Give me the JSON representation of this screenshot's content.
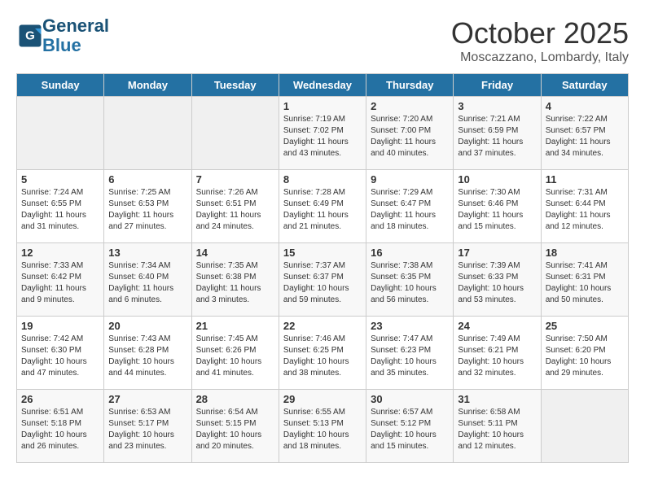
{
  "header": {
    "logo_line1": "General",
    "logo_line2": "Blue",
    "month": "October 2025",
    "location": "Moscazzano, Lombardy, Italy"
  },
  "days_of_week": [
    "Sunday",
    "Monday",
    "Tuesday",
    "Wednesday",
    "Thursday",
    "Friday",
    "Saturday"
  ],
  "weeks": [
    [
      {
        "day": "",
        "info": ""
      },
      {
        "day": "",
        "info": ""
      },
      {
        "day": "",
        "info": ""
      },
      {
        "day": "1",
        "info": "Sunrise: 7:19 AM\nSunset: 7:02 PM\nDaylight: 11 hours\nand 43 minutes."
      },
      {
        "day": "2",
        "info": "Sunrise: 7:20 AM\nSunset: 7:00 PM\nDaylight: 11 hours\nand 40 minutes."
      },
      {
        "day": "3",
        "info": "Sunrise: 7:21 AM\nSunset: 6:59 PM\nDaylight: 11 hours\nand 37 minutes."
      },
      {
        "day": "4",
        "info": "Sunrise: 7:22 AM\nSunset: 6:57 PM\nDaylight: 11 hours\nand 34 minutes."
      }
    ],
    [
      {
        "day": "5",
        "info": "Sunrise: 7:24 AM\nSunset: 6:55 PM\nDaylight: 11 hours\nand 31 minutes."
      },
      {
        "day": "6",
        "info": "Sunrise: 7:25 AM\nSunset: 6:53 PM\nDaylight: 11 hours\nand 27 minutes."
      },
      {
        "day": "7",
        "info": "Sunrise: 7:26 AM\nSunset: 6:51 PM\nDaylight: 11 hours\nand 24 minutes."
      },
      {
        "day": "8",
        "info": "Sunrise: 7:28 AM\nSunset: 6:49 PM\nDaylight: 11 hours\nand 21 minutes."
      },
      {
        "day": "9",
        "info": "Sunrise: 7:29 AM\nSunset: 6:47 PM\nDaylight: 11 hours\nand 18 minutes."
      },
      {
        "day": "10",
        "info": "Sunrise: 7:30 AM\nSunset: 6:46 PM\nDaylight: 11 hours\nand 15 minutes."
      },
      {
        "day": "11",
        "info": "Sunrise: 7:31 AM\nSunset: 6:44 PM\nDaylight: 11 hours\nand 12 minutes."
      }
    ],
    [
      {
        "day": "12",
        "info": "Sunrise: 7:33 AM\nSunset: 6:42 PM\nDaylight: 11 hours\nand 9 minutes."
      },
      {
        "day": "13",
        "info": "Sunrise: 7:34 AM\nSunset: 6:40 PM\nDaylight: 11 hours\nand 6 minutes."
      },
      {
        "day": "14",
        "info": "Sunrise: 7:35 AM\nSunset: 6:38 PM\nDaylight: 11 hours\nand 3 minutes."
      },
      {
        "day": "15",
        "info": "Sunrise: 7:37 AM\nSunset: 6:37 PM\nDaylight: 10 hours\nand 59 minutes."
      },
      {
        "day": "16",
        "info": "Sunrise: 7:38 AM\nSunset: 6:35 PM\nDaylight: 10 hours\nand 56 minutes."
      },
      {
        "day": "17",
        "info": "Sunrise: 7:39 AM\nSunset: 6:33 PM\nDaylight: 10 hours\nand 53 minutes."
      },
      {
        "day": "18",
        "info": "Sunrise: 7:41 AM\nSunset: 6:31 PM\nDaylight: 10 hours\nand 50 minutes."
      }
    ],
    [
      {
        "day": "19",
        "info": "Sunrise: 7:42 AM\nSunset: 6:30 PM\nDaylight: 10 hours\nand 47 minutes."
      },
      {
        "day": "20",
        "info": "Sunrise: 7:43 AM\nSunset: 6:28 PM\nDaylight: 10 hours\nand 44 minutes."
      },
      {
        "day": "21",
        "info": "Sunrise: 7:45 AM\nSunset: 6:26 PM\nDaylight: 10 hours\nand 41 minutes."
      },
      {
        "day": "22",
        "info": "Sunrise: 7:46 AM\nSunset: 6:25 PM\nDaylight: 10 hours\nand 38 minutes."
      },
      {
        "day": "23",
        "info": "Sunrise: 7:47 AM\nSunset: 6:23 PM\nDaylight: 10 hours\nand 35 minutes."
      },
      {
        "day": "24",
        "info": "Sunrise: 7:49 AM\nSunset: 6:21 PM\nDaylight: 10 hours\nand 32 minutes."
      },
      {
        "day": "25",
        "info": "Sunrise: 7:50 AM\nSunset: 6:20 PM\nDaylight: 10 hours\nand 29 minutes."
      }
    ],
    [
      {
        "day": "26",
        "info": "Sunrise: 6:51 AM\nSunset: 5:18 PM\nDaylight: 10 hours\nand 26 minutes."
      },
      {
        "day": "27",
        "info": "Sunrise: 6:53 AM\nSunset: 5:17 PM\nDaylight: 10 hours\nand 23 minutes."
      },
      {
        "day": "28",
        "info": "Sunrise: 6:54 AM\nSunset: 5:15 PM\nDaylight: 10 hours\nand 20 minutes."
      },
      {
        "day": "29",
        "info": "Sunrise: 6:55 AM\nSunset: 5:13 PM\nDaylight: 10 hours\nand 18 minutes."
      },
      {
        "day": "30",
        "info": "Sunrise: 6:57 AM\nSunset: 5:12 PM\nDaylight: 10 hours\nand 15 minutes."
      },
      {
        "day": "31",
        "info": "Sunrise: 6:58 AM\nSunset: 5:11 PM\nDaylight: 10 hours\nand 12 minutes."
      },
      {
        "day": "",
        "info": ""
      }
    ]
  ]
}
